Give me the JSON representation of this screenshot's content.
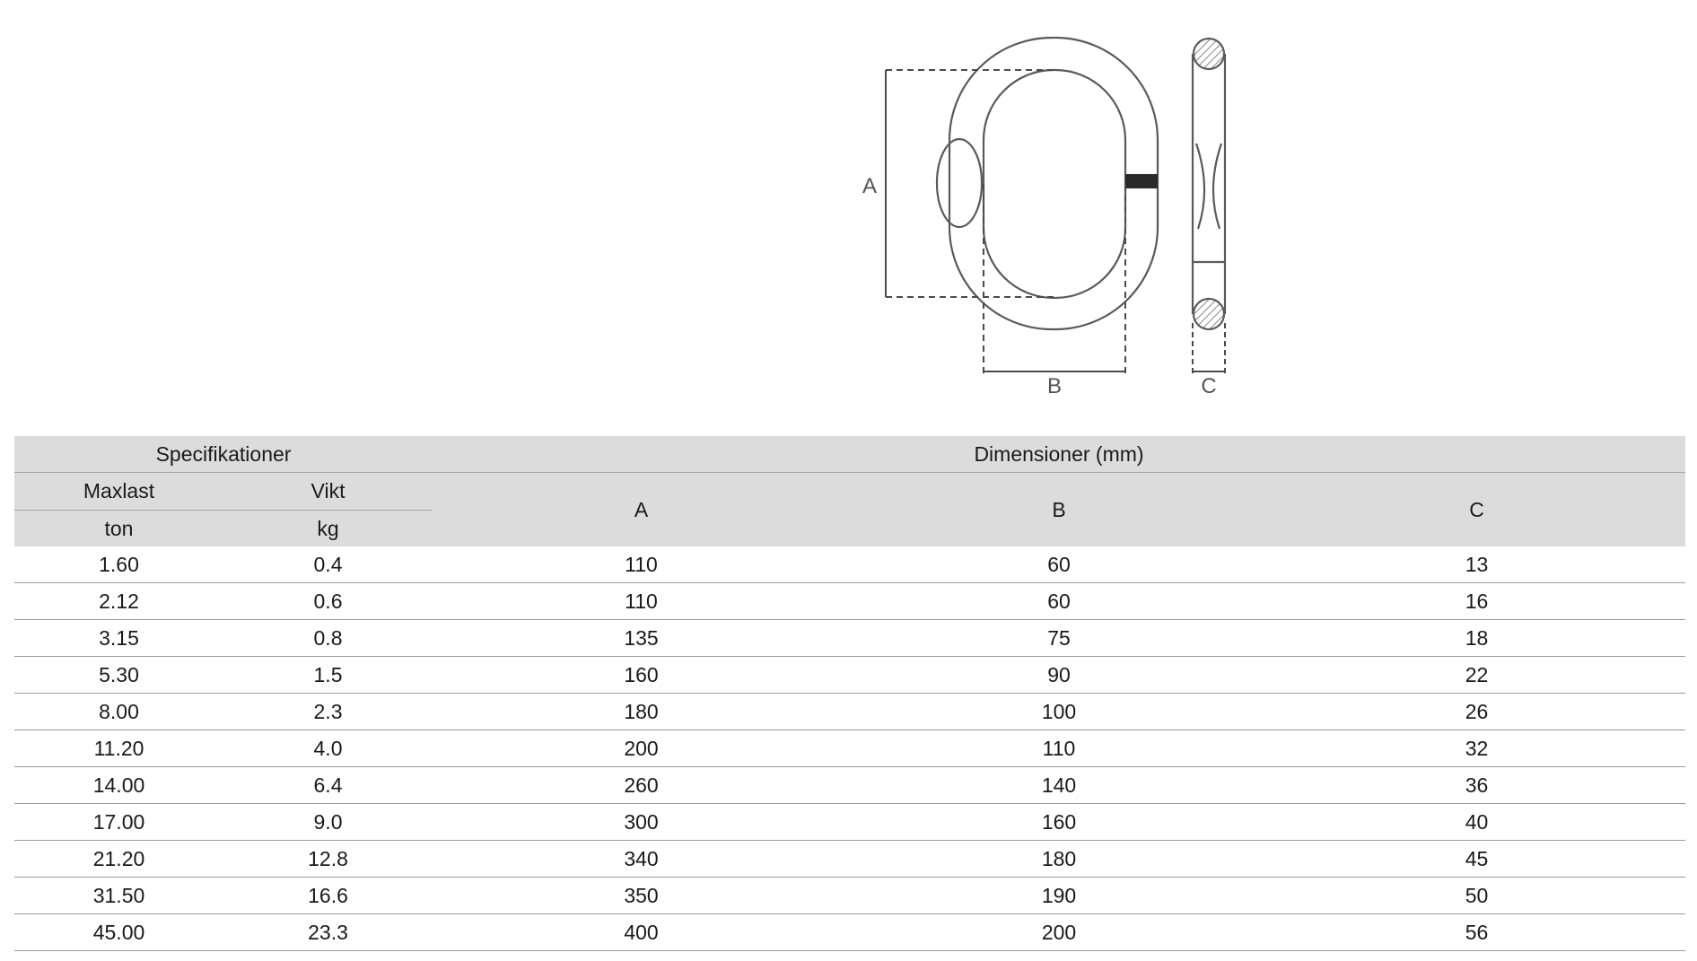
{
  "diagram": {
    "labels": {
      "a": "A",
      "b": "B",
      "c": "C"
    }
  },
  "table": {
    "group_headers": {
      "specs": "Specifikationer",
      "dims": "Dimensioner (mm)"
    },
    "columns": {
      "maxlast": {
        "label": "Maxlast",
        "unit": "ton"
      },
      "vikt": {
        "label": "Vikt",
        "unit": "kg"
      },
      "a": "A",
      "b": "B",
      "c": "C"
    },
    "rows": [
      [
        "1.60",
        "0.4",
        "110",
        "60",
        "13"
      ],
      [
        "2.12",
        "0.6",
        "110",
        "60",
        "16"
      ],
      [
        "3.15",
        "0.8",
        "135",
        "75",
        "18"
      ],
      [
        "5.30",
        "1.5",
        "160",
        "90",
        "22"
      ],
      [
        "8.00",
        "2.3",
        "180",
        "100",
        "26"
      ],
      [
        "11.20",
        "4.0",
        "200",
        "110",
        "32"
      ],
      [
        "14.00",
        "6.4",
        "260",
        "140",
        "36"
      ],
      [
        "17.00",
        "9.0",
        "300",
        "160",
        "40"
      ],
      [
        "21.20",
        "12.8",
        "340",
        "180",
        "45"
      ],
      [
        "31.50",
        "16.6",
        "350",
        "190",
        "50"
      ],
      [
        "45.00",
        "23.3",
        "400",
        "200",
        "56"
      ]
    ]
  }
}
